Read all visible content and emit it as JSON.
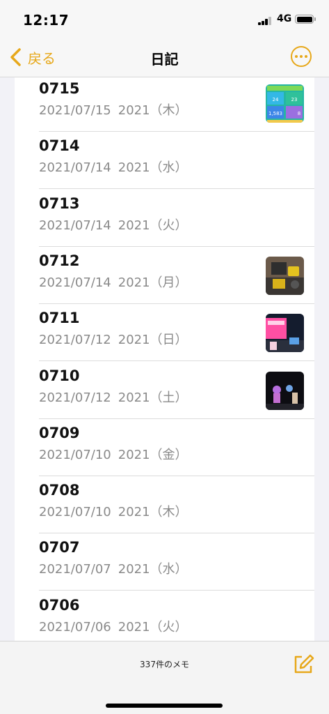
{
  "status_bar": {
    "time": "12:17",
    "network": "4G"
  },
  "nav": {
    "back_label": "戻る",
    "title": "日記"
  },
  "notes": [
    {
      "title": "0715",
      "date": "2021/07/15",
      "preview": "2021（木）",
      "thumbnail": "activity-stats"
    },
    {
      "title": "0714",
      "date": "2021/07/14",
      "preview": "2021（水）"
    },
    {
      "title": "0713",
      "date": "2021/07/14",
      "preview": "2021（火）"
    },
    {
      "title": "0712",
      "date": "2021/07/14",
      "preview": "2021（月）",
      "thumbnail": "photo-desk"
    },
    {
      "title": "0711",
      "date": "2021/07/12",
      "preview": "2021（日）",
      "thumbnail": "photo-pink-sign"
    },
    {
      "title": "0710",
      "date": "2021/07/12",
      "preview": "2021（土）",
      "thumbnail": "photo-dark-room"
    },
    {
      "title": "0709",
      "date": "2021/07/10",
      "preview": "2021（金）"
    },
    {
      "title": "0708",
      "date": "2021/07/10",
      "preview": "2021（木）"
    },
    {
      "title": "0707",
      "date": "2021/07/07",
      "preview": "2021（水）"
    },
    {
      "title": "0706",
      "date": "2021/07/06",
      "preview": "2021（火）"
    }
  ],
  "thumbnails": {
    "activity-stats": {
      "values": [
        "24",
        "23",
        "1,583",
        "8"
      ]
    }
  },
  "toolbar": {
    "note_count": "337件のメモ"
  },
  "colors": {
    "accent": "#e7a81a",
    "subtitle": "#8a8a8a",
    "background": "#f2f2f7"
  },
  "icons": {
    "back": "chevron-left-icon",
    "more": "ellipsis-circle-icon",
    "compose": "compose-icon"
  }
}
